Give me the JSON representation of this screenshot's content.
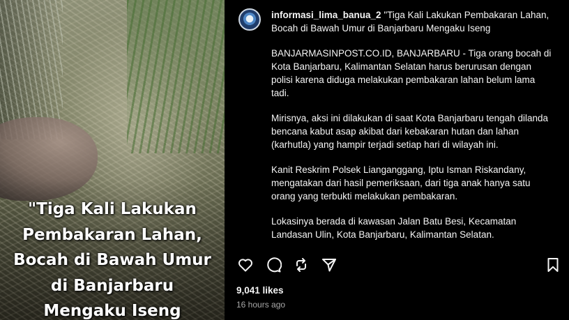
{
  "media": {
    "caption_lines": [
      "\"Tiga Kali Lakukan",
      "Pembakaran Lahan,",
      "Bocah di Bawah Umur",
      "di Banjarbaru",
      "Mengaku Iseng"
    ]
  },
  "post": {
    "username": "informasi_lima_banua_2",
    "paragraphs": [
      "\"Tiga Kali Lakukan Pembakaran Lahan, Bocah di Bawah Umur di Banjarbaru Mengaku Iseng",
      "BANJARMASINPOST.CO.ID, BANJARBARU - Tiga orang bocah di Kota Banjarbaru, Kalimantan Selatan harus berurusan dengan polisi karena diduga melakukan pembakaran lahan belum lama tadi.",
      "Mirisnya, aksi ini dilakukan di saat Kota Banjarbaru tengah dilanda bencana kabut asap akibat dari kebakaran hutan dan lahan (karhutla) yang hampir terjadi setiap hari di wilayah ini.",
      "Kanit Reskrim Polsek Lianganggang, Iptu Isman Riskandany, mengatakan dari hasil pemeriksaan, dari tiga anak hanya satu orang yang terbukti melakukan pembakaran.",
      "Lokasinya berada di kawasan Jalan Batu Besi, Kecamatan Landasan Ulin, Kota Banjarbaru, Kalimantan Selatan."
    ]
  },
  "actions": {
    "icons": [
      "heart-icon",
      "comment-icon",
      "repost-icon",
      "share-icon",
      "bookmark-icon"
    ]
  },
  "stats": {
    "likes": "9,041 likes",
    "time": "16 hours ago"
  },
  "colors": {
    "background": "#000000",
    "text": "#f5f5f5",
    "muted": "#a8a8a8"
  }
}
